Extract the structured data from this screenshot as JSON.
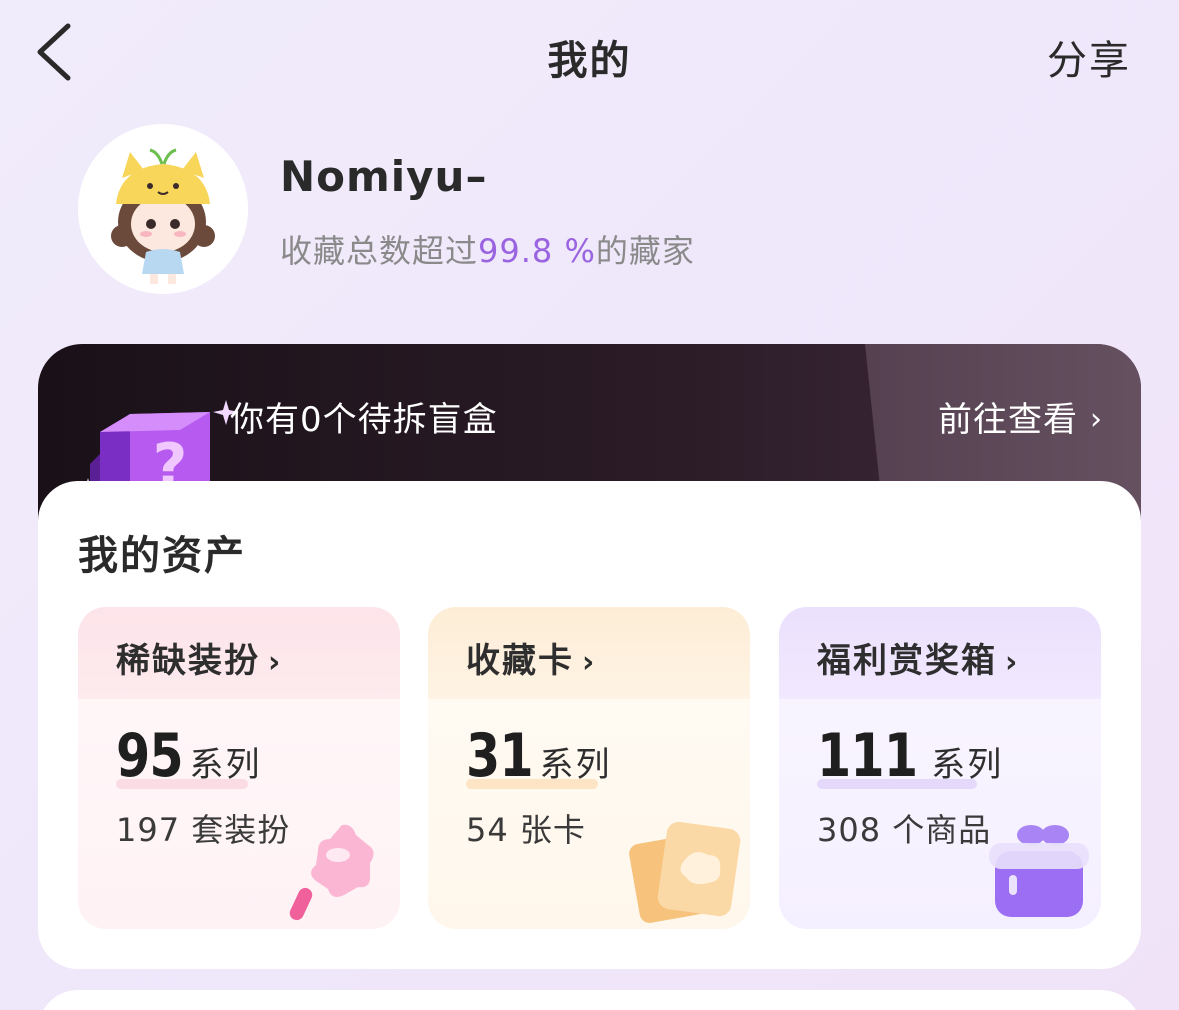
{
  "nav": {
    "back_icon": "chevron-left-icon",
    "title": "我的",
    "share_label": "分享"
  },
  "profile": {
    "username": "Nomiyu–",
    "rank_prefix": "收藏总数超过",
    "rank_percent": "99.8 %",
    "rank_suffix": "的藏家",
    "colors": {
      "percent": "#9a63e0"
    }
  },
  "banner": {
    "icon": "mystery-box-icon",
    "text": "你有0个待拆盲盒",
    "link_label": "前往查看",
    "link_icon": "chevron-right-icon"
  },
  "assets": {
    "title": "我的资产",
    "tiles": [
      {
        "label": "稀缺装扮",
        "chevron": "›",
        "count": "95",
        "unit": "系列",
        "sub": "197 套装扮",
        "icon": "star-wand-icon",
        "color": "#fde4ea"
      },
      {
        "label": "收藏卡",
        "chevron": "›",
        "count": "31",
        "unit": "系列",
        "sub": "54 张卡",
        "icon": "cards-icon",
        "color": "#fdedd6"
      },
      {
        "label": "福利赏奖箱",
        "chevron": "›",
        "count": "111",
        "unit": "系列",
        "sub": "308 个商品",
        "icon": "gift-box-icon",
        "color": "#ebe0fd"
      }
    ]
  }
}
